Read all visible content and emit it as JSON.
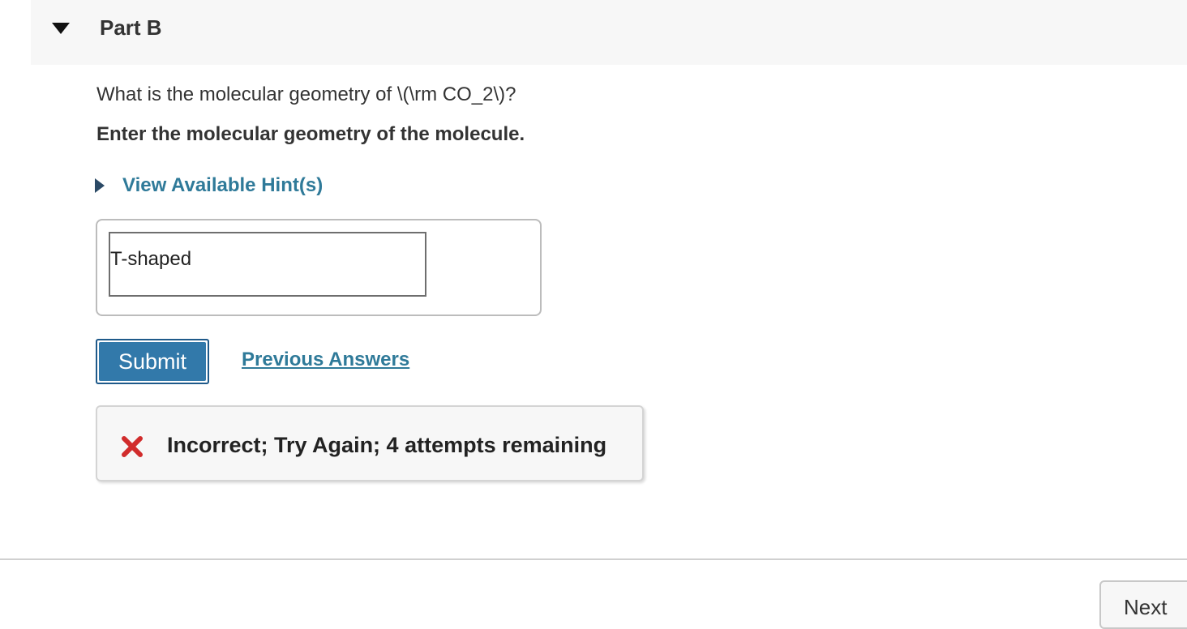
{
  "part": {
    "title": "Part B",
    "toggle_icon": "triangle-down-icon"
  },
  "question": {
    "text": "What is the molecular geometry of \\(\\rm CO_2\\)?",
    "instruction": "Enter the molecular geometry of the molecule."
  },
  "hint": {
    "label": "View Available Hint(s)",
    "icon": "triangle-right-icon"
  },
  "answer": {
    "value": "T-shaped"
  },
  "actions": {
    "submit_label": "Submit",
    "previous_answers_label": "Previous Answers"
  },
  "feedback": {
    "icon": "x-mark-icon",
    "text": "Incorrect; Try Again; 4 attempts remaining"
  },
  "footer": {
    "next_label": "Next"
  },
  "colors": {
    "link": "#2f7a99",
    "submit_bg": "#3279aa",
    "incorrect_red": "#d12c2c",
    "header_bg": "#f7f7f7"
  }
}
